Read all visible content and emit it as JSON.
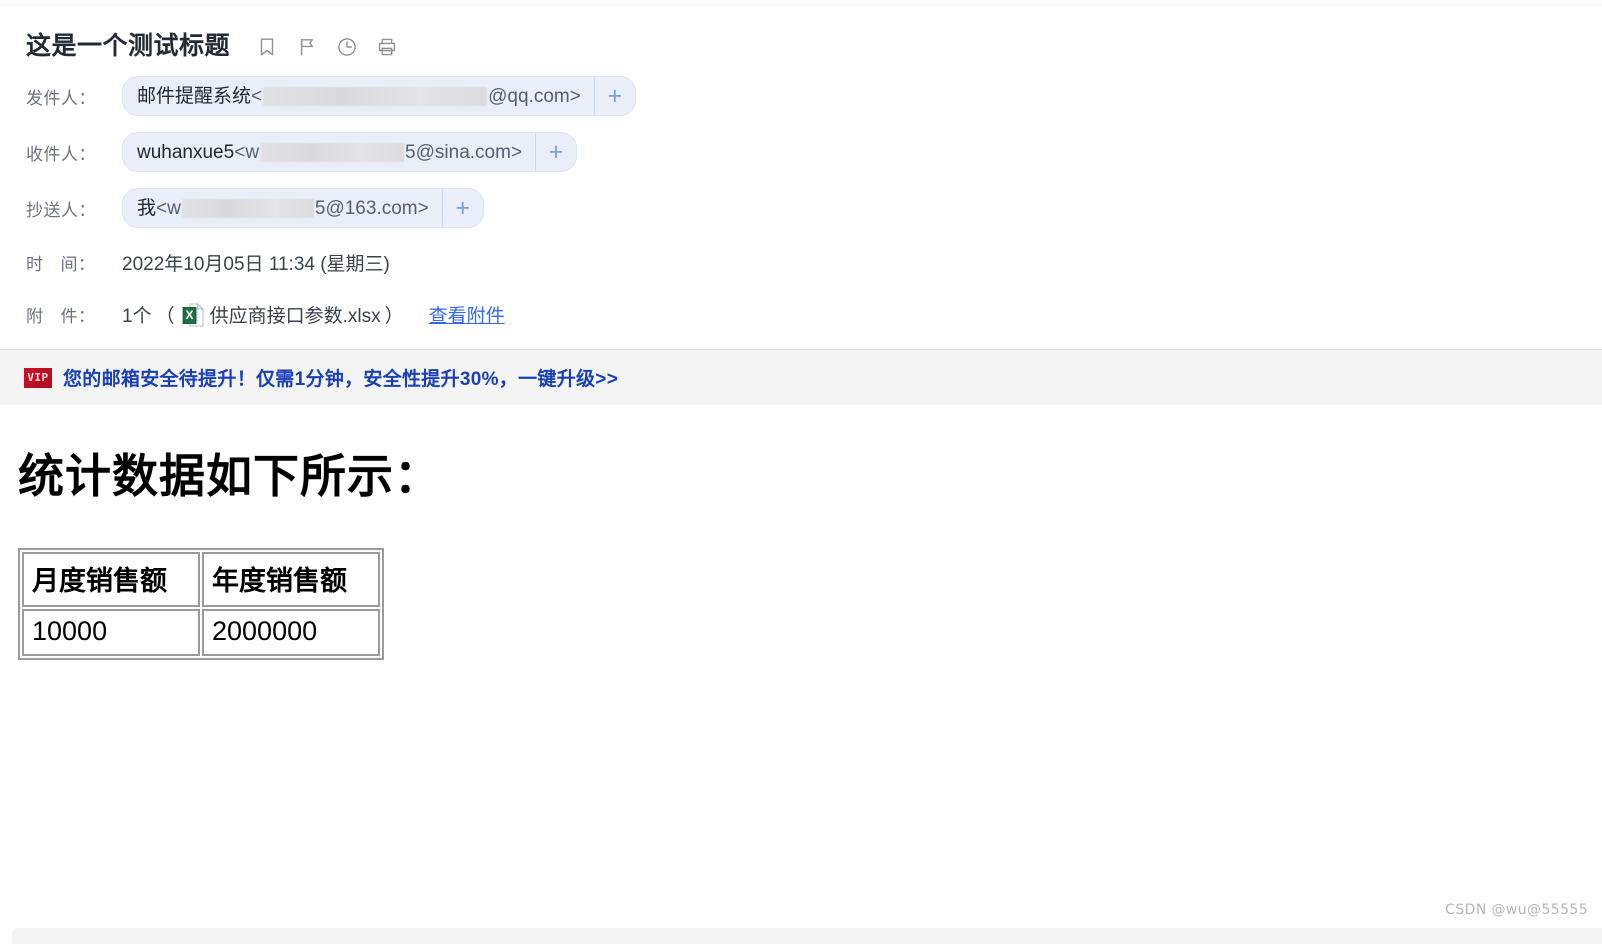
{
  "header": {
    "subject": "这是一个测试标题",
    "icons": [
      {
        "name": "bookmark-icon",
        "label": "收藏"
      },
      {
        "name": "flag-icon",
        "label": "标记"
      },
      {
        "name": "clock-icon",
        "label": "定时"
      },
      {
        "name": "printer-icon",
        "label": "打印"
      }
    ]
  },
  "fields": {
    "from": {
      "label": "发件人：",
      "display_name": "邮件提醒系统",
      "open_angle": "<",
      "address_prefix": "",
      "address_redacted": true,
      "domain": "@qq.com",
      "close_angle": ">",
      "add_label": "+"
    },
    "to": {
      "label": "收件人：",
      "display_name": "wuhanxue5",
      "open_angle": "<",
      "address_prefix": "w",
      "address_redacted": true,
      "address_suffix": "5",
      "domain": "@sina.com",
      "close_angle": ">",
      "add_label": "+"
    },
    "cc": {
      "label": "抄送人：",
      "display_name": "我",
      "open_angle": "<",
      "address_prefix": "w",
      "address_redacted": true,
      "address_suffix": "5",
      "domain": "@163.com",
      "close_angle": ">",
      "add_label": "+"
    },
    "time": {
      "label_a": "时",
      "label_b": "间：",
      "value": "2022年10月05日 11:34 (星期三)"
    },
    "attachment": {
      "label_a": "附",
      "label_b": "件：",
      "count": "1个",
      "open_paren": "（",
      "icon": "excel-file-icon",
      "filename": "供应商接口参数.xlsx",
      "close_paren": "）",
      "link": "查看附件"
    }
  },
  "promo": {
    "badge": "VIP",
    "text": "您的邮箱安全待提升！仅需1分钟，安全性提升30%，一键升级>>",
    "color": "#1940b8",
    "badge_color": "#c21027"
  },
  "body": {
    "heading": "统计数据如下所示："
  },
  "chart_data": {
    "type": "table",
    "title": "统计数据如下所示：",
    "columns": [
      "月度销售额",
      "年度销售额"
    ],
    "rows": [
      [
        "10000",
        "2000000"
      ]
    ]
  },
  "watermark": {
    "text": "CSDN @wu@55555"
  }
}
